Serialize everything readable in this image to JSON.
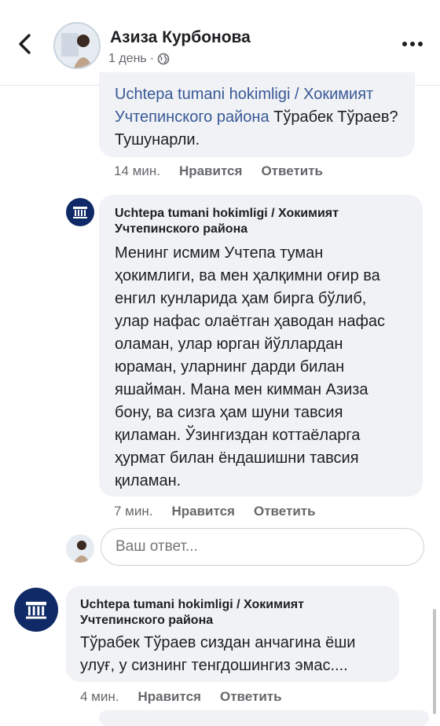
{
  "header": {
    "author_name": "Азиза Курбонова",
    "time": "1 день",
    "separator": "·",
    "back_icon": "chevron-left-icon",
    "more_icon": "more-horizontal-icon",
    "audience_icon": "globe-icon"
  },
  "comments": [
    {
      "author": "",
      "mention": "Uchtepa tumani hokimligi / Хокимият Учтепинского района",
      "text": " Тўрабек Тўраев? Тушунарли.",
      "time": "14 мин.",
      "like_label": "Нравится",
      "reply_label": "Ответить"
    },
    {
      "author": "Uchtepa tumani hokimligi / Хокимият Учтепинского района",
      "text": "Менинг исмим Учтепа туман ҳокимлиги, ва мен ҳалқимни оғир ва енгил кунларида ҳам бирга бўлиб, улар нафас олаётган ҳаводан нафас оламан, улар юрган йўллардан юраман, уларнинг дарди билан яшайман. Мана мен кимман Азиза бону, ва сизга ҳам шуни тавсия қиламан. Ўзингиздан коттаёларга ҳурмат билан ёндашишни тавсия қиламан.",
      "time": "7 мин.",
      "like_label": "Нравится",
      "reply_label": "Ответить"
    },
    {
      "author": "Uchtepa tumani hokimligi / Хокимият Учтепинского района",
      "text": "Тўрабек Тўраев сиздан анчагина ёши улуғ, у сизнинг тенгдошингиз эмас....",
      "time": "4 мин.",
      "like_label": "Нравится",
      "reply_label": "Ответить"
    }
  ],
  "reply_box": {
    "placeholder": "Ваш ответ..."
  },
  "colors": {
    "link": "#385898",
    "bubble": "#f0f2f5",
    "meta": "#65676b",
    "page_avatar": "#0f2a66"
  }
}
